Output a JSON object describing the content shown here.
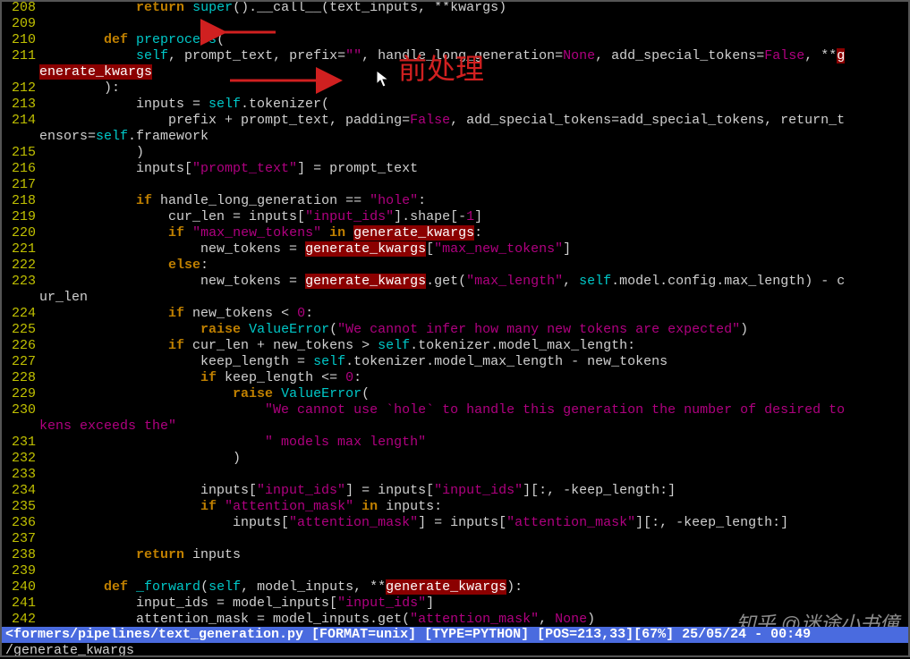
{
  "annotation": {
    "text": "前处理"
  },
  "watermark": "知乎 @迷途小书僮",
  "statusbar": "<formers/pipelines/text_generation.py [FORMAT=unix] [TYPE=PYTHON] [POS=213,33][67%] 25/05/24 - 00:49",
  "cmdline": "/generate_kwargs",
  "search_term": "generate_kwargs",
  "gutter_start": 208,
  "lines": [
    {
      "n": 208,
      "tokens": [
        [
          "id",
          "            "
        ],
        [
          "kw",
          "return"
        ],
        [
          "id",
          " "
        ],
        [
          "fn",
          "super"
        ],
        [
          "punc",
          "().__call__(text_inputs, **kwargs)"
        ]
      ]
    },
    {
      "n": 209,
      "tokens": []
    },
    {
      "n": 210,
      "tokens": [
        [
          "id",
          "        "
        ],
        [
          "kw",
          "def"
        ],
        [
          "id",
          " "
        ],
        [
          "fn",
          "preprocess"
        ],
        [
          "punc",
          "("
        ]
      ]
    },
    {
      "n": 211,
      "tokens": [
        [
          "id",
          "            "
        ],
        [
          "self",
          "self"
        ],
        [
          "punc",
          ", prompt_text, prefix="
        ],
        [
          "str",
          "\"\""
        ],
        [
          "punc",
          ", handle_long_generation="
        ],
        [
          "bool",
          "None"
        ],
        [
          "punc",
          ", add_special_tokens="
        ],
        [
          "bool",
          "False"
        ],
        [
          "punc",
          ", **"
        ],
        [
          "hl",
          "g"
        ]
      ]
    },
    {
      "n": -1,
      "tokens": [
        [
          "hl",
          "enerate_kwargs"
        ]
      ]
    },
    {
      "n": 212,
      "tokens": [
        [
          "id",
          "        ):"
        ]
      ]
    },
    {
      "n": 213,
      "tokens": [
        [
          "id",
          "            inputs = "
        ],
        [
          "self",
          "self"
        ],
        [
          "punc",
          ".tokenizer("
        ]
      ]
    },
    {
      "n": 214,
      "tokens": [
        [
          "id",
          "                prefix + prompt_text, padding="
        ],
        [
          "bool",
          "False"
        ],
        [
          "punc",
          ", add_special_tokens=add_special_tokens, return_t"
        ]
      ]
    },
    {
      "n": -1,
      "tokens": [
        [
          "id",
          "ensors="
        ],
        [
          "self",
          "self"
        ],
        [
          "punc",
          ".framework"
        ]
      ]
    },
    {
      "n": 215,
      "tokens": [
        [
          "id",
          "            )"
        ]
      ]
    },
    {
      "n": 216,
      "tokens": [
        [
          "id",
          "            inputs["
        ],
        [
          "str",
          "\"prompt_text\""
        ],
        [
          "punc",
          "] = prompt_text"
        ]
      ]
    },
    {
      "n": 217,
      "tokens": []
    },
    {
      "n": 218,
      "tokens": [
        [
          "id",
          "            "
        ],
        [
          "kw",
          "if"
        ],
        [
          "id",
          " handle_long_generation == "
        ],
        [
          "str",
          "\"hole\""
        ],
        [
          "punc",
          ":"
        ]
      ]
    },
    {
      "n": 219,
      "tokens": [
        [
          "id",
          "                cur_len = inputs["
        ],
        [
          "str",
          "\"input_ids\""
        ],
        [
          "punc",
          "].shape[-"
        ],
        [
          "num",
          "1"
        ],
        [
          "punc",
          "]"
        ]
      ]
    },
    {
      "n": 220,
      "tokens": [
        [
          "id",
          "                "
        ],
        [
          "kw",
          "if"
        ],
        [
          "id",
          " "
        ],
        [
          "str",
          "\"max_new_tokens\""
        ],
        [
          "id",
          " "
        ],
        [
          "kw",
          "in"
        ],
        [
          "id",
          " "
        ],
        [
          "hl",
          "generate_kwargs"
        ],
        [
          "punc",
          ":"
        ]
      ]
    },
    {
      "n": 221,
      "tokens": [
        [
          "id",
          "                    new_tokens = "
        ],
        [
          "hl",
          "generate_kwargs"
        ],
        [
          "punc",
          "["
        ],
        [
          "str",
          "\"max_new_tokens\""
        ],
        [
          "punc",
          "]"
        ]
      ]
    },
    {
      "n": 222,
      "tokens": [
        [
          "id",
          "                "
        ],
        [
          "kw",
          "else"
        ],
        [
          "punc",
          ":"
        ]
      ]
    },
    {
      "n": 223,
      "tokens": [
        [
          "id",
          "                    new_tokens = "
        ],
        [
          "hl",
          "generate_kwargs"
        ],
        [
          "punc",
          ".get("
        ],
        [
          "str",
          "\"max_length\""
        ],
        [
          "punc",
          ", "
        ],
        [
          "self",
          "self"
        ],
        [
          "punc",
          ".model.config.max_length) - c"
        ]
      ]
    },
    {
      "n": -1,
      "tokens": [
        [
          "id",
          "ur_len"
        ]
      ]
    },
    {
      "n": 224,
      "tokens": [
        [
          "id",
          "                "
        ],
        [
          "kw",
          "if"
        ],
        [
          "id",
          " new_tokens < "
        ],
        [
          "num",
          "0"
        ],
        [
          "punc",
          ":"
        ]
      ]
    },
    {
      "n": 225,
      "tokens": [
        [
          "id",
          "                    "
        ],
        [
          "kw",
          "raise"
        ],
        [
          "id",
          " "
        ],
        [
          "err",
          "ValueError"
        ],
        [
          "punc",
          "("
        ],
        [
          "str",
          "\"We cannot infer how many new tokens are expected\""
        ],
        [
          "punc",
          ")"
        ]
      ]
    },
    {
      "n": 226,
      "tokens": [
        [
          "id",
          "                "
        ],
        [
          "kw",
          "if"
        ],
        [
          "id",
          " cur_len + new_tokens > "
        ],
        [
          "self",
          "self"
        ],
        [
          "punc",
          ".tokenizer.model_max_length:"
        ]
      ]
    },
    {
      "n": 227,
      "tokens": [
        [
          "id",
          "                    keep_length = "
        ],
        [
          "self",
          "self"
        ],
        [
          "punc",
          ".tokenizer.model_max_length - new_tokens"
        ]
      ]
    },
    {
      "n": 228,
      "tokens": [
        [
          "id",
          "                    "
        ],
        [
          "kw",
          "if"
        ],
        [
          "id",
          " keep_length <= "
        ],
        [
          "num",
          "0"
        ],
        [
          "punc",
          ":"
        ]
      ]
    },
    {
      "n": 229,
      "tokens": [
        [
          "id",
          "                        "
        ],
        [
          "kw",
          "raise"
        ],
        [
          "id",
          " "
        ],
        [
          "err",
          "ValueError"
        ],
        [
          "punc",
          "("
        ]
      ]
    },
    {
      "n": 230,
      "tokens": [
        [
          "id",
          "                            "
        ],
        [
          "str",
          "\"We cannot use `hole` to handle this generation the number of desired to"
        ]
      ]
    },
    {
      "n": -1,
      "tokens": [
        [
          "str",
          "kens exceeds the\""
        ]
      ]
    },
    {
      "n": 231,
      "tokens": [
        [
          "id",
          "                            "
        ],
        [
          "str",
          "\" models max length\""
        ]
      ]
    },
    {
      "n": 232,
      "tokens": [
        [
          "id",
          "                        )"
        ]
      ]
    },
    {
      "n": 233,
      "tokens": []
    },
    {
      "n": 234,
      "tokens": [
        [
          "id",
          "                    inputs["
        ],
        [
          "str",
          "\"input_ids\""
        ],
        [
          "punc",
          "] = inputs["
        ],
        [
          "str",
          "\"input_ids\""
        ],
        [
          "punc",
          "][:, -keep_length:]"
        ]
      ]
    },
    {
      "n": 235,
      "tokens": [
        [
          "id",
          "                    "
        ],
        [
          "kw",
          "if"
        ],
        [
          "id",
          " "
        ],
        [
          "str",
          "\"attention_mask\""
        ],
        [
          "id",
          " "
        ],
        [
          "kw",
          "in"
        ],
        [
          "id",
          " inputs:"
        ]
      ]
    },
    {
      "n": 236,
      "tokens": [
        [
          "id",
          "                        inputs["
        ],
        [
          "str",
          "\"attention_mask\""
        ],
        [
          "punc",
          "] = inputs["
        ],
        [
          "str",
          "\"attention_mask\""
        ],
        [
          "punc",
          "][:, -keep_length:]"
        ]
      ]
    },
    {
      "n": 237,
      "tokens": []
    },
    {
      "n": 238,
      "tokens": [
        [
          "id",
          "            "
        ],
        [
          "kw",
          "return"
        ],
        [
          "id",
          " inputs"
        ]
      ]
    },
    {
      "n": 239,
      "tokens": []
    },
    {
      "n": 240,
      "tokens": [
        [
          "id",
          "        "
        ],
        [
          "kw",
          "def"
        ],
        [
          "id",
          " "
        ],
        [
          "fn",
          "_forward"
        ],
        [
          "punc",
          "("
        ],
        [
          "self",
          "self"
        ],
        [
          "punc",
          ", model_inputs, **"
        ],
        [
          "hl",
          "generate_kwargs"
        ],
        [
          "punc",
          "):"
        ]
      ]
    },
    {
      "n": 241,
      "tokens": [
        [
          "id",
          "            input_ids = model_inputs["
        ],
        [
          "str",
          "\"input_ids\""
        ],
        [
          "punc",
          "]"
        ]
      ]
    },
    {
      "n": 242,
      "tokens": [
        [
          "id",
          "            attention_mask = model_inputs.get("
        ],
        [
          "str",
          "\"attention_mask\""
        ],
        [
          "punc",
          ", "
        ],
        [
          "bool",
          "None"
        ],
        [
          "punc",
          ")"
        ]
      ]
    }
  ]
}
